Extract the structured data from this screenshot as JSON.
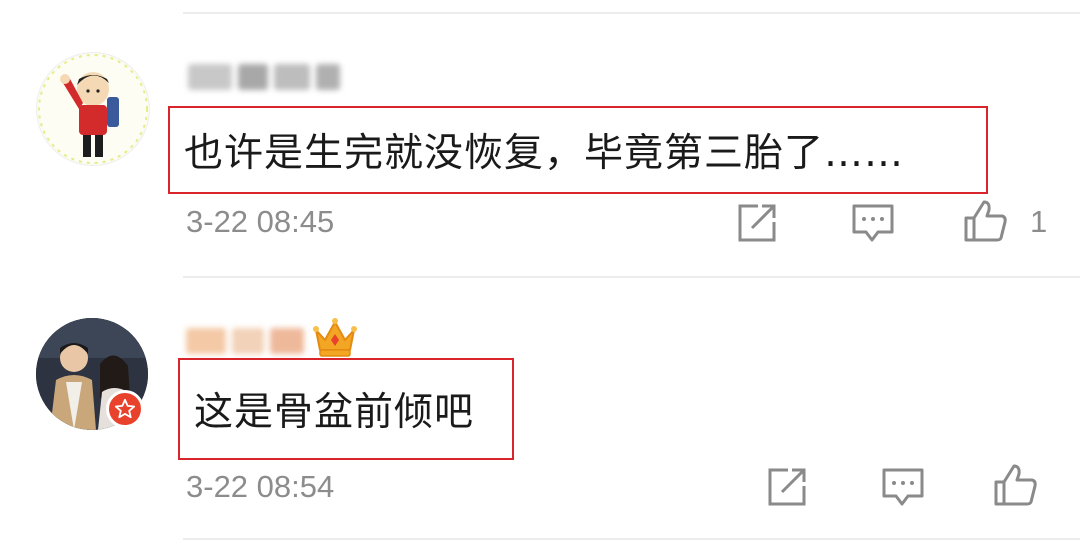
{
  "comments": [
    {
      "username_blurred": true,
      "text": "也许是生完就没恢复，毕竟第三胎了……",
      "timestamp": "3-22 08:45",
      "like_count": "1",
      "actions": [
        "share-icon",
        "reply-icon",
        "like-icon"
      ]
    },
    {
      "username_blurred": true,
      "text": "这是骨盆前倾吧",
      "timestamp": "3-22 08:54",
      "like_count": "",
      "actions": [
        "share-icon",
        "reply-icon",
        "like-icon"
      ],
      "badges": [
        "crown-icon",
        "verified-star-icon"
      ]
    }
  ],
  "colors": {
    "highlight_border": "#d8242b",
    "text_primary": "#1a1a1a",
    "text_secondary": "#8c8c8c",
    "verify_badge": "#e8412c",
    "crown": "#f2a623"
  }
}
